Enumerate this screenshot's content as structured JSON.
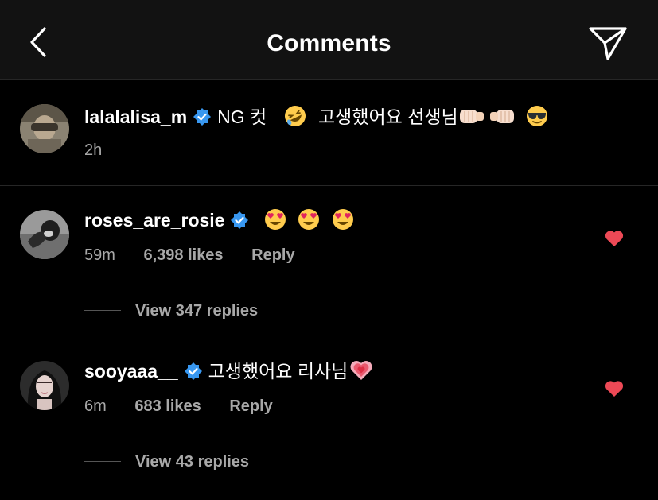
{
  "header": {
    "title": "Comments",
    "back_icon": "chevron-left-icon",
    "share_icon": "paper-plane-icon"
  },
  "caption": {
    "username": "lalalalisa_m",
    "text_a": "NG 컷",
    "text_b": "고생했어요 선생님",
    "time": "2h"
  },
  "comments": [
    {
      "username": "roses_are_rosie",
      "time": "59m",
      "likes": "6,398 likes",
      "reply": "Reply",
      "view_replies": "View 347 replies"
    },
    {
      "username": "sooyaaa__",
      "text": "고생했어요 리사님",
      "time": "6m",
      "likes": "683 likes",
      "reply": "Reply",
      "view_replies": "View 43 replies"
    }
  ],
  "colors": {
    "background": "#000000",
    "header": "#121212",
    "verified": "#3897f0",
    "heart": "#ed4956",
    "secondary_text": "#a8a8a8"
  }
}
